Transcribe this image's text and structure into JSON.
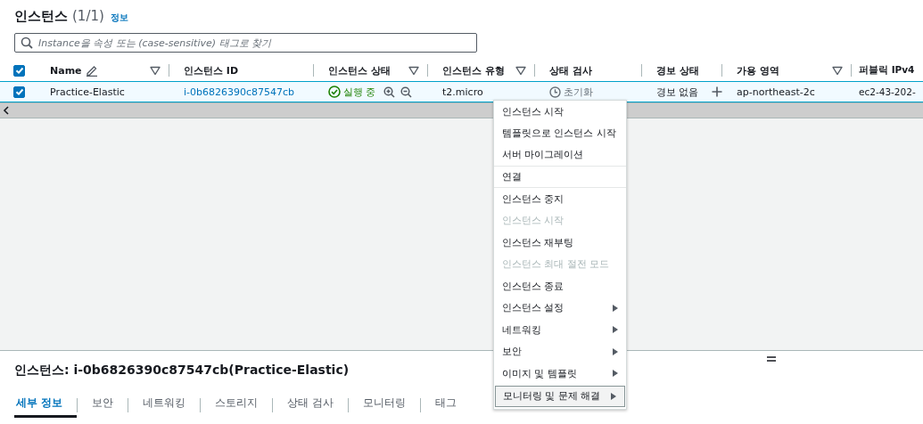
{
  "header": {
    "title": "인스턴스",
    "count": "(1/1)",
    "info_link": "정보"
  },
  "search": {
    "placeholder": "Instance을 속성 또는 (case-sensitive) 태그로 찾기"
  },
  "table": {
    "select_all_checked": true,
    "columns": [
      {
        "label": "Name",
        "editable": true,
        "filter": true
      },
      {
        "label": "인스턴스 ID",
        "editable": false,
        "filter": false
      },
      {
        "label": "인스턴스 상태",
        "editable": false,
        "filter": true
      },
      {
        "label": "인스턴스 유형",
        "editable": false,
        "filter": true
      },
      {
        "label": "상태 검사",
        "editable": false,
        "filter": false
      },
      {
        "label": "경보 상태",
        "editable": false,
        "filter": false
      },
      {
        "label": "가용 영역",
        "editable": false,
        "filter": true
      },
      {
        "label": "퍼블릭 IPv4",
        "editable": false,
        "filter": false
      }
    ],
    "rows": [
      {
        "selected": true,
        "name": "Practice-Elastic",
        "instance_id": "i-0b6826390c87547cb",
        "state": {
          "text": "실행 중",
          "kind": "running"
        },
        "type": "t2.micro",
        "status_check": {
          "text": "초기화",
          "kind": "initializing"
        },
        "alarm": "경보 없음",
        "availability_zone": "ap-northeast-2c",
        "public_ipv4": "ec2-43-202-"
      }
    ]
  },
  "context_menu": [
    {
      "label": "인스턴스 시작",
      "kind": "action",
      "disabled": false,
      "highlighted": false,
      "divider_after": false
    },
    {
      "label": "템플릿으로 인스턴스 시작",
      "kind": "action",
      "disabled": false,
      "highlighted": false,
      "divider_after": false
    },
    {
      "label": "서버 마이그레이션",
      "kind": "action",
      "disabled": false,
      "highlighted": false,
      "divider_after": true
    },
    {
      "label": "연결",
      "kind": "action",
      "disabled": false,
      "highlighted": false,
      "divider_after": true
    },
    {
      "label": "인스턴스 중지",
      "kind": "action",
      "disabled": false,
      "highlighted": false,
      "divider_after": false
    },
    {
      "label": "인스턴스 시작",
      "kind": "action",
      "disabled": true,
      "highlighted": false,
      "divider_after": false
    },
    {
      "label": "인스턴스 재부팅",
      "kind": "action",
      "disabled": false,
      "highlighted": false,
      "divider_after": false
    },
    {
      "label": "인스턴스 최대 절전 모드",
      "kind": "action",
      "disabled": true,
      "highlighted": false,
      "divider_after": false
    },
    {
      "label": "인스턴스 종료",
      "kind": "action",
      "disabled": false,
      "highlighted": false,
      "divider_after": false
    },
    {
      "label": "인스턴스 설정",
      "kind": "submenu",
      "disabled": false,
      "highlighted": false,
      "divider_after": false
    },
    {
      "label": "네트워킹",
      "kind": "submenu",
      "disabled": false,
      "highlighted": false,
      "divider_after": false
    },
    {
      "label": "보안",
      "kind": "submenu",
      "disabled": false,
      "highlighted": false,
      "divider_after": false
    },
    {
      "label": "이미지 및 템플릿",
      "kind": "submenu",
      "disabled": false,
      "highlighted": false,
      "divider_after": false
    },
    {
      "label": "모니터링 및 문제 해결",
      "kind": "submenu",
      "disabled": false,
      "highlighted": true,
      "divider_after": false
    }
  ],
  "details": {
    "title": "인스턴스: i-0b6826390c87547cb(Practice-Elastic)",
    "tabs": [
      {
        "label": "세부 정보",
        "selected": true
      },
      {
        "label": "보안",
        "selected": false
      },
      {
        "label": "네트워킹",
        "selected": false
      },
      {
        "label": "스토리지",
        "selected": false
      },
      {
        "label": "상태 검사",
        "selected": false
      },
      {
        "label": "모니터링",
        "selected": false
      },
      {
        "label": "태그",
        "selected": false
      }
    ]
  }
}
